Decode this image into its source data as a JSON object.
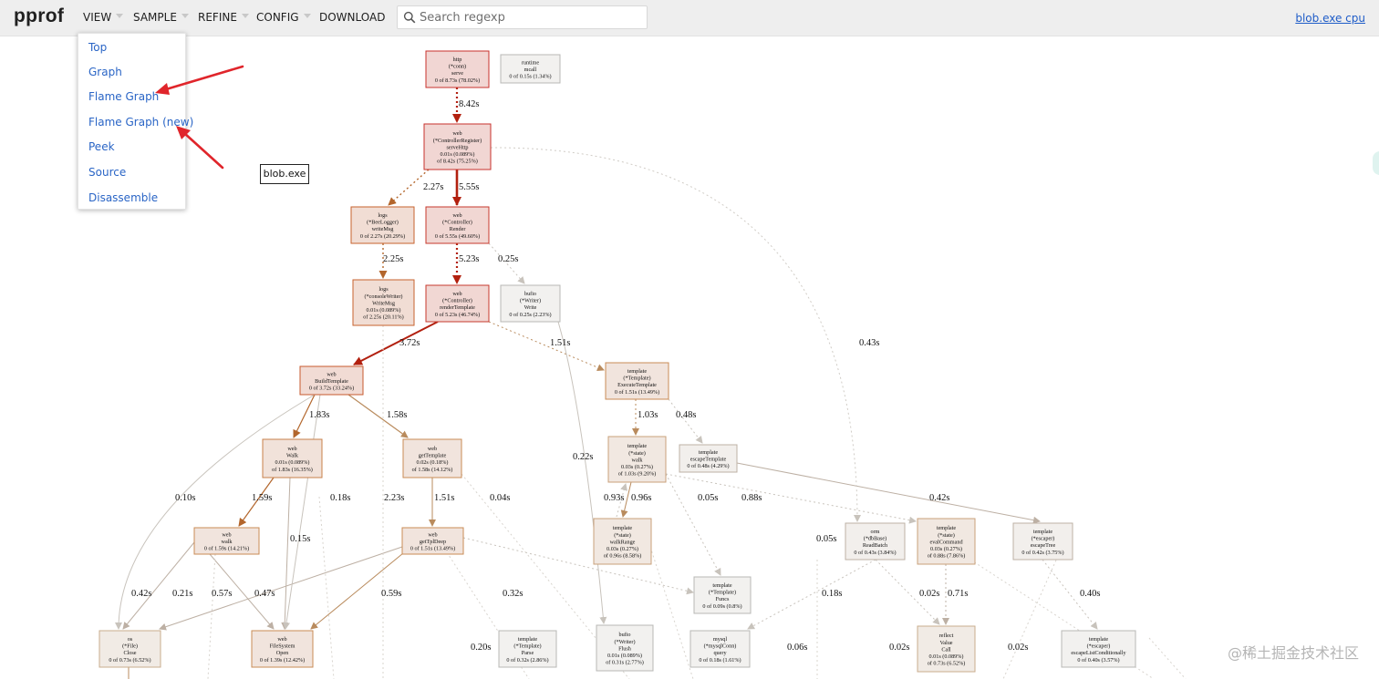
{
  "header": {
    "logo": "pprof",
    "menus": [
      {
        "label": "VIEW"
      },
      {
        "label": "SAMPLE"
      },
      {
        "label": "REFINE"
      },
      {
        "label": "CONFIG"
      },
      {
        "label": "DOWNLOAD"
      }
    ],
    "search_placeholder": "Search regexp",
    "profile_link": "blob.exe cpu"
  },
  "view_menu": {
    "items": [
      "Top",
      "Graph",
      "Flame Graph",
      "Flame Graph (new)",
      "Peek",
      "Source",
      "Disassemble"
    ]
  },
  "graph": {
    "legend_label": "blob.exe",
    "nodes": [
      {
        "id": "n1",
        "lines": [
          "http",
          "(*conn)",
          "serve",
          "0 of 8.73s (78.02%)"
        ],
        "color": "#f1d6d3",
        "border": "#c8322d"
      },
      {
        "id": "n2",
        "lines": [
          "runtime",
          "mcall",
          "0 of 0.15s (1.34%)"
        ],
        "color": "#f2f1ef",
        "border": "#b8b8b6"
      },
      {
        "id": "n3",
        "lines": [
          "web",
          "(*ControllerRegister)",
          "serveHttp",
          "0.01s (0.089%)",
          "of 8.42s (75.25%)"
        ],
        "color": "#f1d6d3",
        "border": "#c8322d"
      },
      {
        "id": "n4",
        "lines": [
          "logs",
          "(*BeeLogger)",
          "writeMsg",
          "0 of 2.27s (20.29%)"
        ],
        "color": "#f1ddd4",
        "border": "#c7622e"
      },
      {
        "id": "n5",
        "lines": [
          "web",
          "(*Controller)",
          "Render",
          "0 of 5.55s (49.60%)"
        ],
        "color": "#f1d7d3",
        "border": "#c73a2d"
      },
      {
        "id": "n6",
        "lines": [
          "logs",
          "(*consoleWriter)",
          "WriteMsg",
          "0.01s (0.089%)",
          "of 2.25s (20.11%)"
        ],
        "color": "#f1ddd4",
        "border": "#c7622e"
      },
      {
        "id": "n7",
        "lines": [
          "web",
          "(*Controller)",
          "renderTemplate",
          "0 of 5.23s (46.74%)"
        ],
        "color": "#f1d7d3",
        "border": "#c73a2d"
      },
      {
        "id": "n8",
        "lines": [
          "bufio",
          "(*Writer)",
          "Write",
          "0 of 0.25s (2.23%)"
        ],
        "color": "#f2f1ef",
        "border": "#b8b8b6"
      },
      {
        "id": "n9",
        "lines": [
          "web",
          "BuildTemplate",
          "0 of 3.72s (33.24%)"
        ],
        "color": "#f1dbd4",
        "border": "#c75a2e"
      },
      {
        "id": "n10",
        "lines": [
          "template",
          "(*Template)",
          "ExecuteTemplate",
          "0 of 1.51s (13.49%)"
        ],
        "color": "#f1e4dd",
        "border": "#c98b55"
      },
      {
        "id": "n11",
        "lines": [
          "web",
          "Walk",
          "0.01s (0.089%)",
          "of 1.83s (16.35%)"
        ],
        "color": "#f1e2da",
        "border": "#c8804a"
      },
      {
        "id": "n12",
        "lines": [
          "web",
          "getTemplate",
          "0.02s (0.18%)",
          "of 1.58s (14.12%)"
        ],
        "color": "#f1e4dd",
        "border": "#c98b55"
      },
      {
        "id": "n13",
        "lines": [
          "template",
          "(*state)",
          "walk",
          "0.03s (0.27%)",
          "of 1.03s (9.20%)"
        ],
        "color": "#f1e8e1",
        "border": "#c9a07a"
      },
      {
        "id": "n14",
        "lines": [
          "template",
          "escapeTemplate",
          "0 of 0.48s (4.29%)"
        ],
        "color": "#f2efec",
        "border": "#bdb0a4"
      },
      {
        "id": "n15",
        "lines": [
          "web",
          "walk",
          "0 of 1.59s (14.21%)"
        ],
        "color": "#f1e4dd",
        "border": "#c98b55"
      },
      {
        "id": "n16",
        "lines": [
          "web",
          "getTplDeep",
          "0 of 1.51s (13.49%)"
        ],
        "color": "#f1e4dd",
        "border": "#c98b55"
      },
      {
        "id": "n17",
        "lines": [
          "template",
          "(*state)",
          "walkRange",
          "0.03s (0.27%)",
          "of 0.96s (8.58%)"
        ],
        "color": "#f1e8e1",
        "border": "#c9a07a"
      },
      {
        "id": "n18",
        "lines": [
          "orm",
          "(*dbBase)",
          "ReadBatch",
          "0 of 0.43s (3.84%)"
        ],
        "color": "#f2efec",
        "border": "#bdb0a4"
      },
      {
        "id": "n19",
        "lines": [
          "template",
          "(*state)",
          "evalCommand",
          "0.03s (0.27%)",
          "of 0.88s (7.86%)"
        ],
        "color": "#f1e8e1",
        "border": "#c9a07a"
      },
      {
        "id": "n20",
        "lines": [
          "template",
          "(*escaper)",
          "escapeTree",
          "0 of 0.42s (3.75%)"
        ],
        "color": "#f2efec",
        "border": "#bdb0a4"
      },
      {
        "id": "n21",
        "lines": [
          "template",
          "(*Template)",
          "Funcs",
          "0 of 0.09s (0.8%)"
        ],
        "color": "#f2f1ef",
        "border": "#b8b8b6"
      },
      {
        "id": "n22",
        "lines": [
          "os",
          "(*File)",
          "Close",
          "0 of 0.73s (6.52%)"
        ],
        "color": "#f1ebe5",
        "border": "#c9ad8d"
      },
      {
        "id": "n23",
        "lines": [
          "web",
          "FileSystem",
          "Open",
          "0 of 1.39s (12.42%)"
        ],
        "color": "#f1e4dd",
        "border": "#c98b55"
      },
      {
        "id": "n24",
        "lines": [
          "template",
          "(*Template)",
          "Parse",
          "0 of 0.32s (2.86%)"
        ],
        "color": "#f2f1ef",
        "border": "#b8b8b6"
      },
      {
        "id": "n25",
        "lines": [
          "bufio",
          "(*Writer)",
          "Flush",
          "0.01s (0.089%)",
          "of 0.31s (2.77%)"
        ],
        "color": "#f2f1ef",
        "border": "#b8b8b6"
      },
      {
        "id": "n26",
        "lines": [
          "mysql",
          "(*mysqlConn)",
          "query",
          "0 of 0.18s (1.61%)"
        ],
        "color": "#f2f1ef",
        "border": "#b8b8b6"
      },
      {
        "id": "n27",
        "lines": [
          "reflect",
          "Value",
          "Call",
          "0.01s (0.089%)",
          "of 0.73s (6.52%)"
        ],
        "color": "#f1ebe5",
        "border": "#c9ad8d"
      },
      {
        "id": "n28",
        "lines": [
          "template",
          "(*escaper)",
          "escapeListConditionally",
          "0 of 0.40s (3.57%)"
        ],
        "color": "#f2f1ef",
        "border": "#b8b8b6"
      }
    ],
    "edge_labels": [
      {
        "id": "e1",
        "text": "8.42s"
      },
      {
        "id": "e2",
        "text": "2.27s"
      },
      {
        "id": "e3",
        "text": "5.55s"
      },
      {
        "id": "e4",
        "text": "2.25s"
      },
      {
        "id": "e5",
        "text": "5.23s"
      },
      {
        "id": "e6",
        "text": "0.25s"
      },
      {
        "id": "e7",
        "text": "0.43s"
      },
      {
        "id": "e8",
        "text": "3.72s"
      },
      {
        "id": "e9",
        "text": "1.51s"
      },
      {
        "id": "e10",
        "text": "1.83s"
      },
      {
        "id": "e11",
        "text": "1.58s"
      },
      {
        "id": "e12",
        "text": "1.03s"
      },
      {
        "id": "e13",
        "text": "0.48s"
      },
      {
        "id": "e14",
        "text": "0.22s"
      },
      {
        "id": "e15",
        "text": "0.10s"
      },
      {
        "id": "e16",
        "text": "1.59s"
      },
      {
        "id": "e17",
        "text": "0.18s"
      },
      {
        "id": "e18",
        "text": "2.23s"
      },
      {
        "id": "e19",
        "text": "1.51s"
      },
      {
        "id": "e20",
        "text": "0.04s"
      },
      {
        "id": "e21",
        "text": "0.93s"
      },
      {
        "id": "e22",
        "text": "0.96s"
      },
      {
        "id": "e23",
        "text": "0.05s"
      },
      {
        "id": "e24",
        "text": "0.88s"
      },
      {
        "id": "e25",
        "text": "0.42s"
      },
      {
        "id": "e26",
        "text": "0.15s"
      },
      {
        "id": "e27",
        "text": "0.05s"
      },
      {
        "id": "e28",
        "text": "0.42s"
      },
      {
        "id": "e29",
        "text": "0.21s"
      },
      {
        "id": "e30",
        "text": "0.57s"
      },
      {
        "id": "e31",
        "text": "0.47s"
      },
      {
        "id": "e32",
        "text": "0.59s"
      },
      {
        "id": "e33",
        "text": "0.32s"
      },
      {
        "id": "e34",
        "text": "0.18s"
      },
      {
        "id": "e35",
        "text": "0.02s"
      },
      {
        "id": "e36",
        "text": "0.71s"
      },
      {
        "id": "e37",
        "text": "0.40s"
      },
      {
        "id": "e38",
        "text": "0.20s"
      },
      {
        "id": "e39",
        "text": "0.06s"
      },
      {
        "id": "e40",
        "text": "0.02s"
      },
      {
        "id": "e41",
        "text": "0.02s"
      }
    ]
  },
  "watermark": "@稀土掘金技术社区",
  "colors": {
    "annotation_arrow": "#e0252b",
    "link": "#2a65c6",
    "header_bg": "#eeeeee"
  }
}
